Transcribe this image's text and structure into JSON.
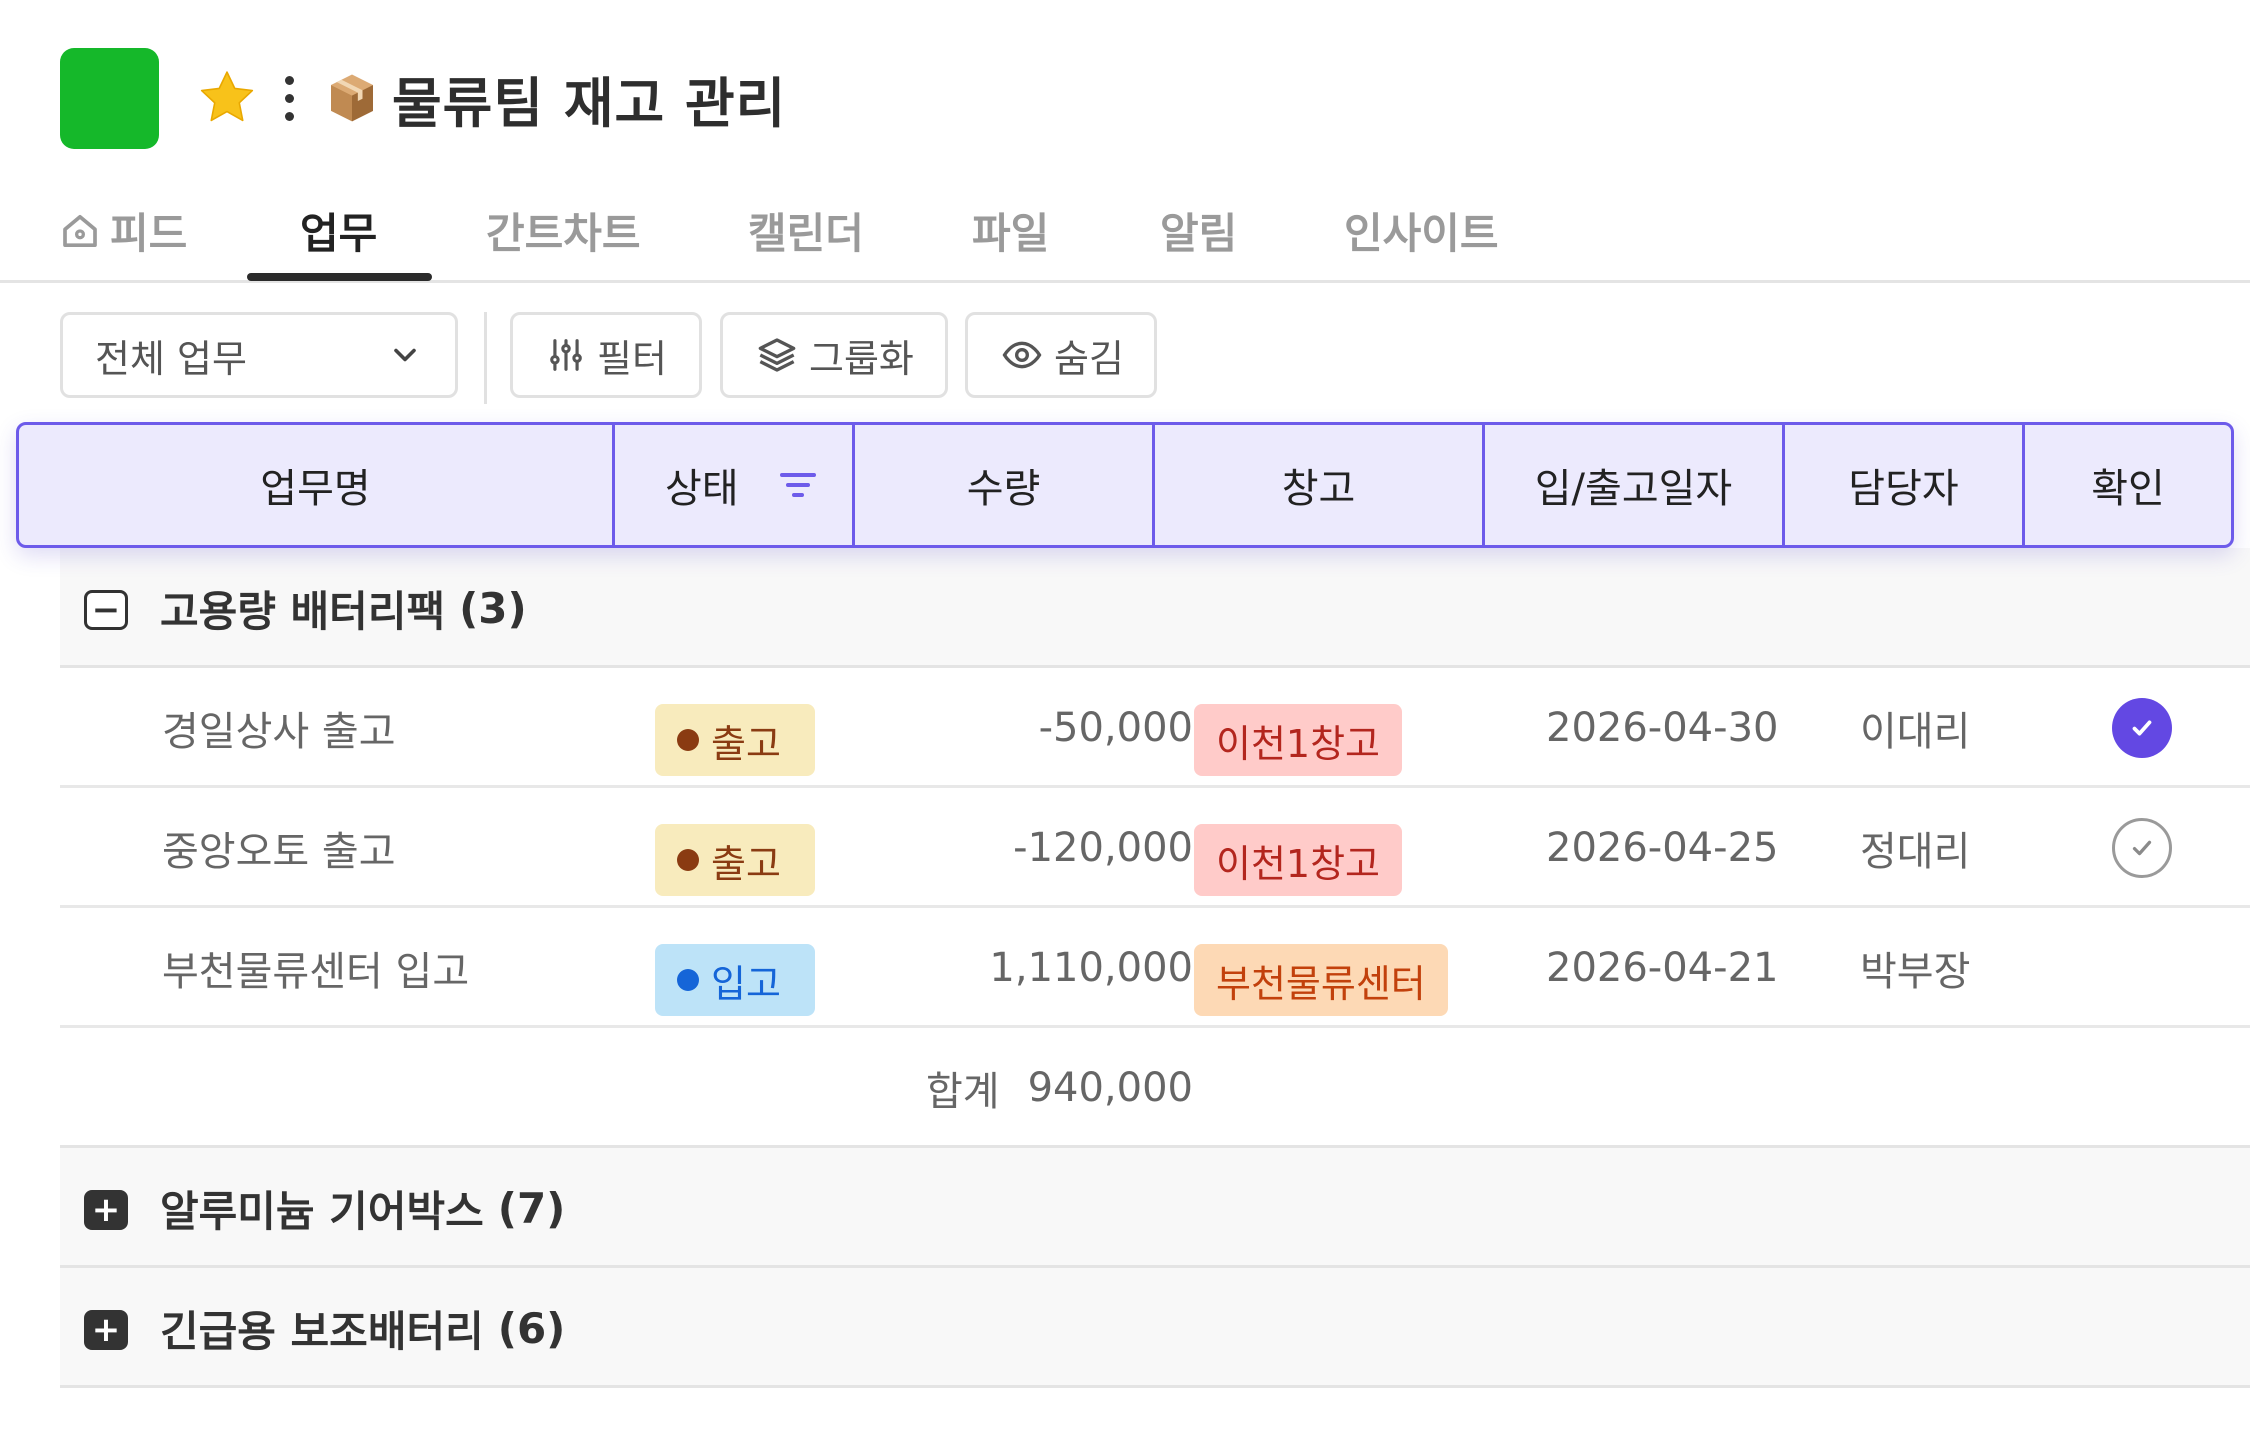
{
  "header": {
    "title": "물류팀 재고 관리",
    "logo_color": "#15b82a",
    "favorite_icon": "star-icon",
    "title_emoji_icon": "package-box-icon"
  },
  "tabs": [
    {
      "label": "피드",
      "icon": "home-icon",
      "active": false
    },
    {
      "label": "업무",
      "active": true
    },
    {
      "label": "간트차트",
      "active": false
    },
    {
      "label": "캘린더",
      "active": false
    },
    {
      "label": "파일",
      "active": false
    },
    {
      "label": "알림",
      "active": false
    },
    {
      "label": "인사이트",
      "active": false
    }
  ],
  "toolbar": {
    "view_select": "전체 업무",
    "filter_label": "필터",
    "group_label": "그룹화",
    "hide_label": "숨김"
  },
  "columns": [
    "업무명",
    "상태",
    "수량",
    "창고",
    "입/출고일자",
    "담당자",
    "확인"
  ],
  "groups": [
    {
      "name": "고용량 배터리팩",
      "count": "(3)",
      "expanded": true,
      "rows": [
        {
          "task": "경일상사 출고",
          "status": "출고",
          "quantity": "-50,000",
          "warehouse": "이천1창고",
          "date": "2026-04-30",
          "assignee": "이대리",
          "confirmed": true
        },
        {
          "task": "중앙오토 출고",
          "status": "출고",
          "quantity": "-120,000",
          "warehouse": "이천1창고",
          "date": "2026-04-25",
          "assignee": "정대리",
          "confirmed": false
        },
        {
          "task": "부천물류센터 입고",
          "status": "입고",
          "quantity": "1,110,000",
          "warehouse": "부천물류센터",
          "date": "2026-04-21",
          "assignee": "박부장",
          "confirmed": null
        }
      ],
      "sum_label": "합계",
      "sum_value": "940,000"
    },
    {
      "name": "알루미늄 기어박스",
      "count": "(7)",
      "expanded": false
    },
    {
      "name": "긴급용 보조배터리",
      "count": "(6)",
      "expanded": false
    }
  ],
  "colors": {
    "accent": "#6d5bea",
    "status_out_bg": "#f8ebbd",
    "status_out_dot": "#8a3b12",
    "status_in_bg": "#bde3f8",
    "status_in_dot": "#1565d8",
    "warehouse_icheon_bg": "#ffcbc9",
    "warehouse_icheon_text": "#b3261e",
    "warehouse_bucheon_bg": "#fdd9b5",
    "warehouse_bucheon_text": "#c2410c"
  }
}
